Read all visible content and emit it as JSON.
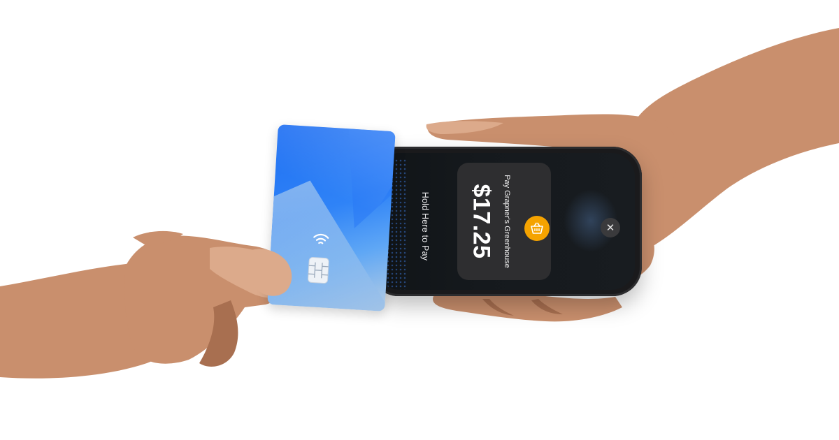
{
  "phone_screen": {
    "instruction": "Hold Here to Pay",
    "merchant_label": "Pay Grapner's Greenhouse",
    "amount": "$17.25",
    "close_symbol": "✕"
  },
  "icons": {
    "merchant": "basket-icon",
    "close": "close-icon",
    "contactless": "contactless-icon",
    "chip": "chip-icon"
  },
  "colors": {
    "card_blue": "#1f6ff2",
    "merchant_badge": "#f5a300",
    "phone_body": "#1a1a1c",
    "payment_sheet": "#2e2e30"
  }
}
